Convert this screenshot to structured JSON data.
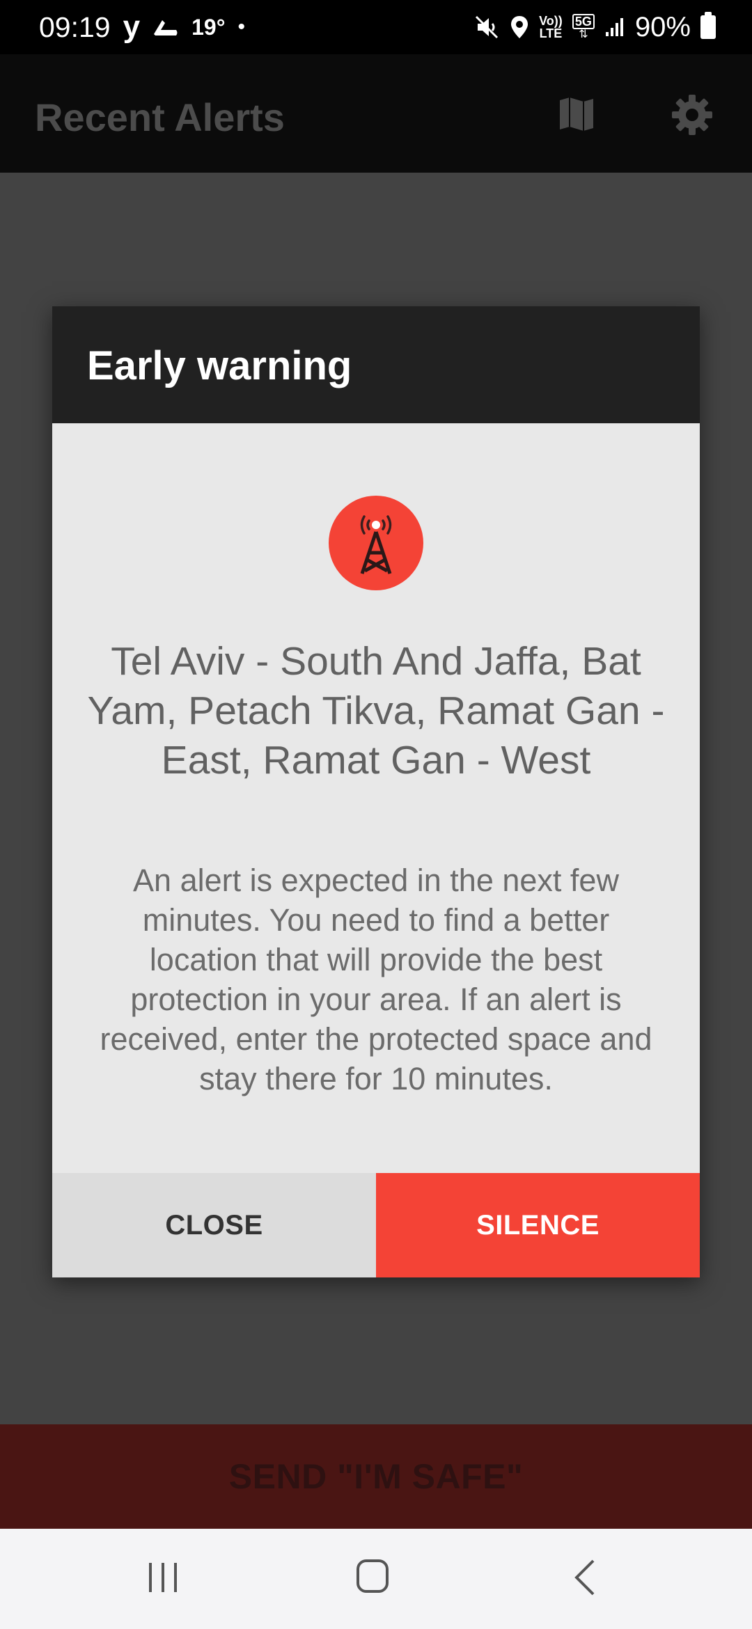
{
  "status_bar": {
    "time": "09:19",
    "carrier": "y",
    "temperature": "19°",
    "dot": "•",
    "volte": "Vo)) LTE",
    "network": "5G",
    "battery": "90%"
  },
  "app_bar": {
    "title": "Recent Alerts",
    "map_icon": "map-icon",
    "settings_icon": "gear-icon"
  },
  "dialog": {
    "title": "Early warning",
    "icon": "radio-tower-icon",
    "cities": "Tel Aviv - South And Jaffa, Bat Yam, Petach Tikva, Ramat Gan - East, Ramat Gan - West",
    "description": "An alert is expected in the next few minutes. You need to find a better location that will provide the best protection in your area. If an alert is received, enter the protected space and stay there for 10 minutes.",
    "close_label": "CLOSE",
    "silence_label": "SILENCE"
  },
  "safe_button": {
    "label": "SEND \"I'M SAFE\""
  },
  "colors": {
    "accent": "#f44336",
    "dialog_header": "#212121",
    "dialog_body": "#e8e8e8",
    "overlay": "#434343"
  }
}
